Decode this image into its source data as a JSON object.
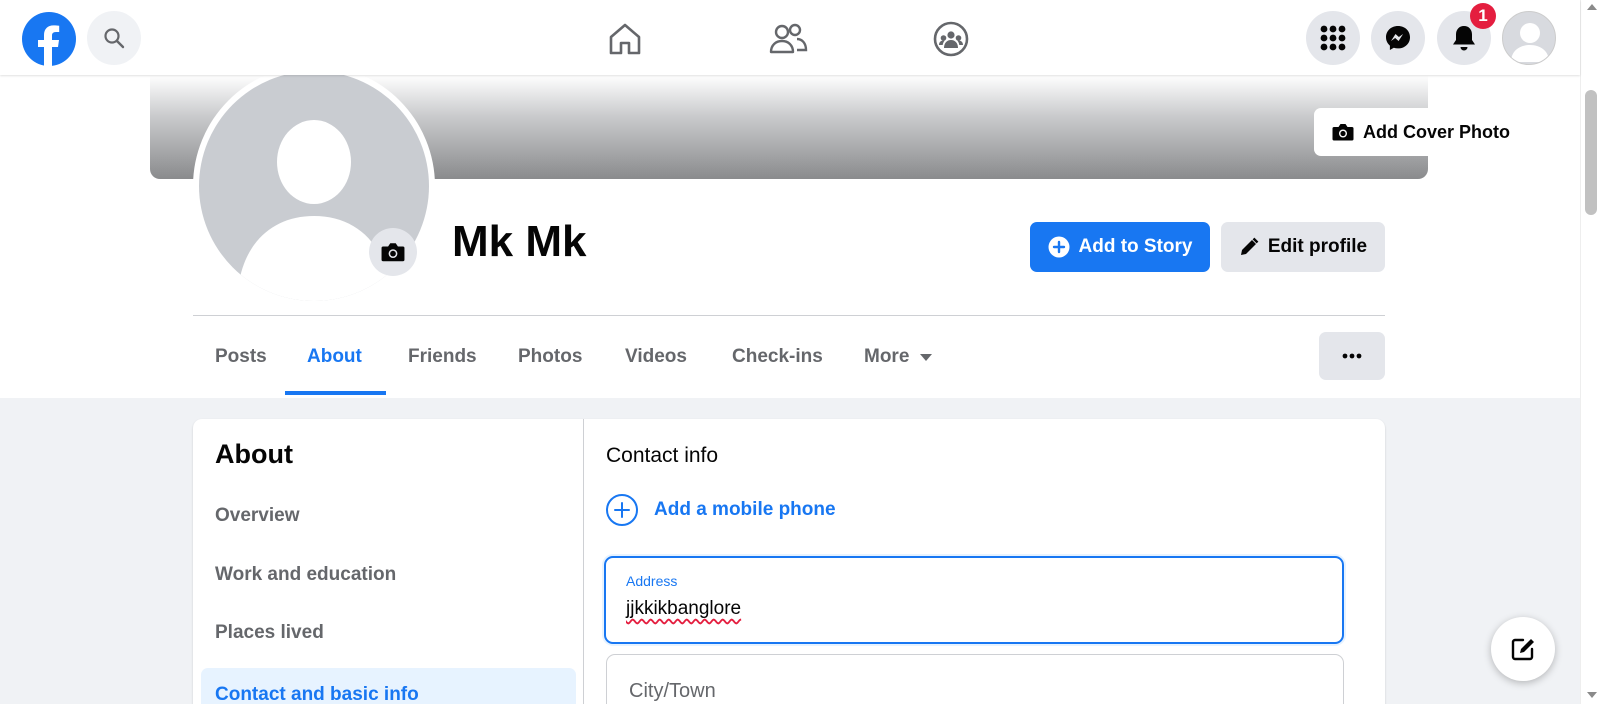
{
  "nav": {
    "notification_count": "1"
  },
  "profile": {
    "name": "Mk Mk",
    "add_cover_photo": "Add Cover Photo",
    "add_to_story": "Add to Story",
    "edit_profile": "Edit profile"
  },
  "tabs": [
    {
      "label": "Posts"
    },
    {
      "label": "About"
    },
    {
      "label": "Friends"
    },
    {
      "label": "Photos"
    },
    {
      "label": "Videos"
    },
    {
      "label": "Check-ins"
    },
    {
      "label": "More"
    }
  ],
  "about": {
    "title": "About",
    "items": [
      {
        "label": "Overview"
      },
      {
        "label": "Work and education"
      },
      {
        "label": "Places lived"
      },
      {
        "label": "Contact and basic info"
      }
    ]
  },
  "contact": {
    "title": "Contact info",
    "add_phone": "Add a mobile phone",
    "address_label": "Address",
    "address_value": "jjkkikbanglore",
    "city_placeholder": "City/Town"
  },
  "colors": {
    "accent": "#1877f2",
    "badge": "#e41e3f",
    "secondary_text": "#65676b"
  }
}
